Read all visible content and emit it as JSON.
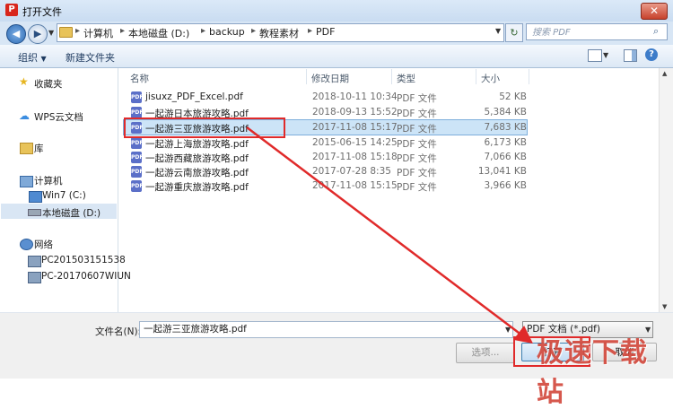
{
  "window": {
    "title": "打开文件",
    "app_icon": "wps-pdf-icon",
    "close_label": "✕"
  },
  "address": {
    "crumbs": [
      "计算机",
      "本地磁盘 (D:)",
      "backup",
      "教程素材",
      "PDF"
    ],
    "search_placeholder": "搜索 PDF"
  },
  "toolbar": {
    "organize": "组织",
    "new_folder": "新建文件夹"
  },
  "nav": {
    "favorites": "收藏夹",
    "wps_docs": "WPS云文档",
    "library": "库",
    "computer": "计算机",
    "drive_c": "Win7 (C:)",
    "drive_d": "本地磁盘 (D:)",
    "network": "网络",
    "pc1": "PC201503151538",
    "pc2": "PC-20170607WIUN"
  },
  "columns": {
    "name": "名称",
    "date": "修改日期",
    "type": "类型",
    "size": "大小"
  },
  "files": [
    {
      "name": "jisuxz_PDF_Excel.pdf",
      "date": "2018-10-11 10:34",
      "type": "PDF 文件",
      "size": "52 KB"
    },
    {
      "name": "一起游日本旅游攻略.pdf",
      "date": "2018-09-13 15:52",
      "type": "PDF 文件",
      "size": "5,384 KB"
    },
    {
      "name": "一起游三亚旅游攻略.pdf",
      "date": "2017-11-08 15:17",
      "type": "PDF 文件",
      "size": "7,683 KB"
    },
    {
      "name": "一起游上海旅游攻略.pdf",
      "date": "2015-06-15 14:25",
      "type": "PDF 文件",
      "size": "6,173 KB"
    },
    {
      "name": "一起游西藏旅游攻略.pdf",
      "date": "2017-11-08 15:18",
      "type": "PDF 文件",
      "size": "7,066 KB"
    },
    {
      "name": "一起游云南旅游攻略.pdf",
      "date": "2017-07-28 8:35",
      "type": "PDF 文件",
      "size": "13,041 KB"
    },
    {
      "name": "一起游重庆旅游攻略.pdf",
      "date": "2017-11-08 15:15",
      "type": "PDF 文件",
      "size": "3,966 KB"
    }
  ],
  "selected_index": 2,
  "footer": {
    "filename_label": "文件名(N):",
    "filename_value": "一起游三亚旅游攻略.pdf",
    "filter_value": "PDF 文档 (*.pdf)",
    "options_label": "选项...",
    "open_label": "打开",
    "cancel_label": "取消"
  },
  "watermark": "极速下载站",
  "colors": {
    "highlight": "#e02a2a",
    "selection": "#cce4f7",
    "titlebar": "#c9dcf1"
  }
}
